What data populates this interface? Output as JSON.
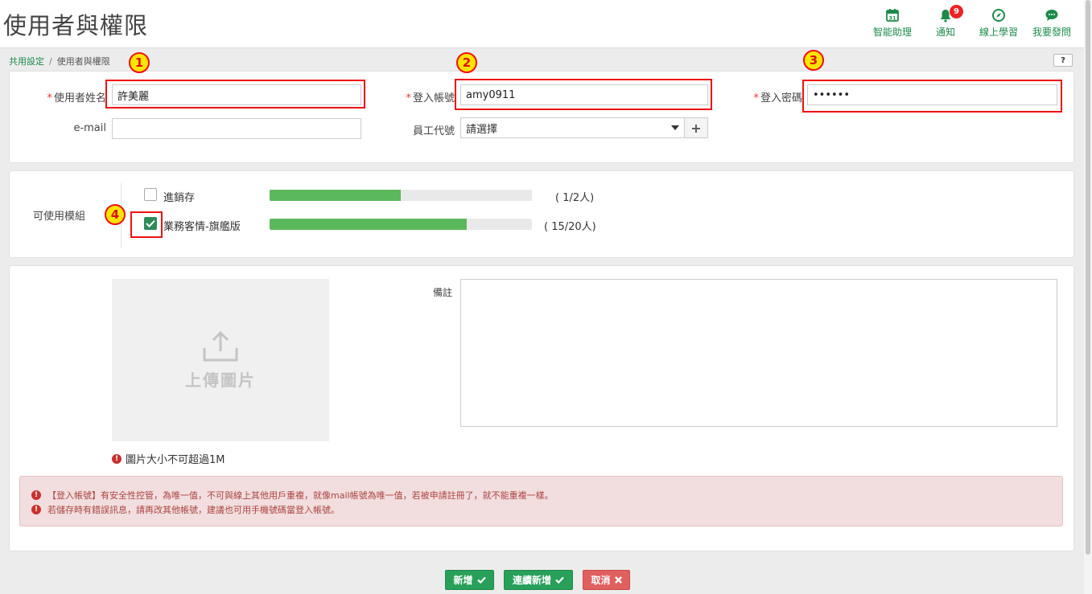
{
  "page": {
    "title": "使用者與權限"
  },
  "top_icons": [
    {
      "label": "智能助理",
      "icon": "calendar-icon"
    },
    {
      "label": "通知",
      "icon": "bell-icon",
      "badge": "9"
    },
    {
      "label": "線上學習",
      "icon": "compass-icon"
    },
    {
      "label": "我要發問",
      "icon": "chat-icon"
    }
  ],
  "breadcrumb": {
    "parent": "共用設定",
    "separator": "/",
    "current": "使用者與權限"
  },
  "help": {
    "label": "?"
  },
  "form": {
    "name_label": "使用者姓名",
    "name_value": "許美麗",
    "account_label": "登入帳號",
    "account_value": "amy0911",
    "password_label": "登入密碼",
    "password_value": "••••••",
    "email_label": "e-mail",
    "email_value": "",
    "employee_label": "員工代號",
    "employee_value": "請選擇",
    "plus": "+"
  },
  "modules": {
    "label": "可使用模組",
    "items": [
      {
        "name": "進銷存",
        "checked": false,
        "usage": "( 1/2人)",
        "fraction": 0.5
      },
      {
        "name": "業務客情-旗艦版",
        "checked": true,
        "usage": "( 15/20人)",
        "fraction": 0.75
      }
    ]
  },
  "upload": {
    "label": "上傳圖片",
    "note": "圖片大小不可超過1M"
  },
  "remark": {
    "label": "備註",
    "value": ""
  },
  "alert": {
    "lines": [
      "【登入帳號】有安全性控管，為唯一值，不可與線上其他用戶重複，就像mail帳號為唯一值，若被申請註冊了，就不能重複一樣。",
      "若儲存時有錯誤訊息，請再改其他帳號，建議也可用手機號碼當登入帳號。"
    ]
  },
  "markers": [
    "1",
    "2",
    "3",
    "4"
  ],
  "buttons": {
    "add": "新增",
    "add_continue": "連續新增",
    "cancel": "取消"
  },
  "colors": {
    "accent": "#1c8a4a",
    "progress": "#5cb85c",
    "highlight": "#e11111",
    "marker_fill": "#ffe400"
  }
}
